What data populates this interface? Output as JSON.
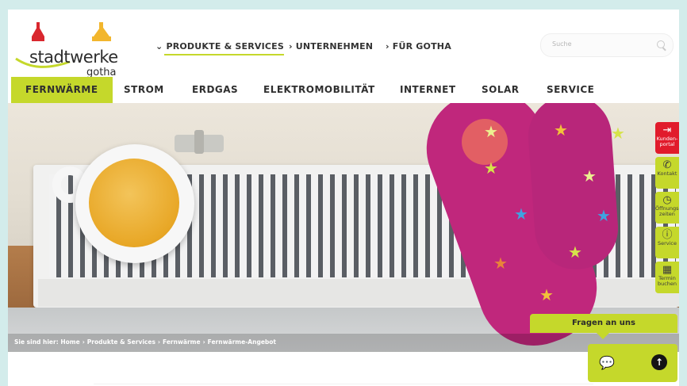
{
  "header": {
    "logo_text": "stadtwerke",
    "logo_sub": "gotha",
    "topnav": [
      {
        "label": "PRODUKTE & SERVICES"
      },
      {
        "label": "UNTERNEHMEN"
      },
      {
        "label": "FÜR GOTHA"
      }
    ],
    "search": {
      "placeholder": "Suche"
    }
  },
  "mainnav": {
    "items": [
      {
        "label": "FERNWÄRME"
      },
      {
        "label": "STROM"
      },
      {
        "label": "ERDGAS"
      },
      {
        "label": "ELEKTROMOBILITÄT"
      },
      {
        "label": "INTERNET"
      },
      {
        "label": "SOLAR"
      },
      {
        "label": "SERVICE"
      }
    ]
  },
  "breadcrumb": {
    "prefix": "Sie sind hier:",
    "items": [
      "Home",
      "Produkte & Services",
      "Fernwärme",
      "Fernwärme-Angebot"
    ],
    "separator": "›"
  },
  "side_tools": [
    {
      "label": "Kunden-portal",
      "icon": "login-icon"
    },
    {
      "label": "Kontakt",
      "icon": "phone-icon"
    },
    {
      "label": "Öffnungs-zeiten",
      "icon": "clock-icon"
    },
    {
      "label": "Service",
      "icon": "info-icon"
    },
    {
      "label": "Termin buchen",
      "icon": "calendar-icon"
    }
  ],
  "chat": {
    "label": "Fragen an uns"
  },
  "colors": {
    "accent": "#c5d82b",
    "portal_red": "#e11b2b",
    "background": "#d3eceb"
  }
}
